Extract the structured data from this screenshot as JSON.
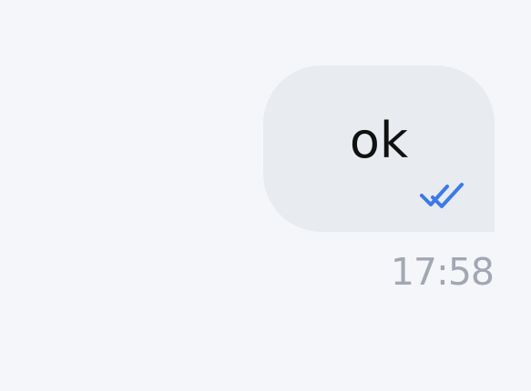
{
  "message": {
    "text": "ok",
    "status_icon": "double-check-icon",
    "status_color": "#3d7ae6",
    "timestamp": "17:58"
  },
  "colors": {
    "background": "#f5f6fa",
    "bubble": "#e8ebef",
    "text": "#111111",
    "timestamp": "#a1a7b3"
  }
}
